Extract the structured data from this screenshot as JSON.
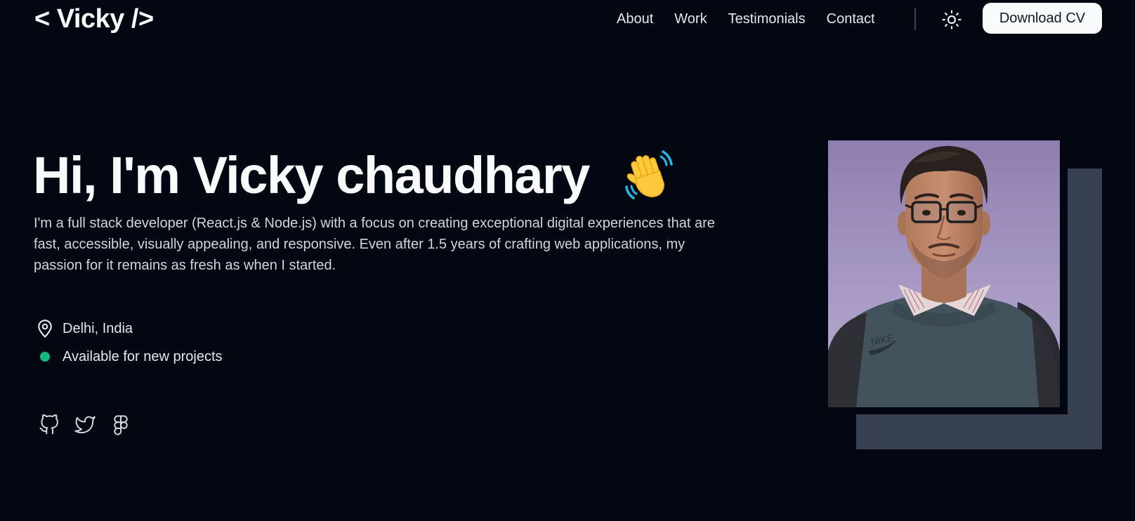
{
  "header": {
    "logo": "< Vicky />",
    "nav": [
      {
        "label": "About"
      },
      {
        "label": "Work"
      },
      {
        "label": "Testimonials"
      },
      {
        "label": "Contact"
      }
    ],
    "theme_toggle_icon": "sun-icon",
    "download_label": "Download CV"
  },
  "hero": {
    "title": "Hi, I'm Vicky chaudhary",
    "title_icon": "waving-hand-emoji",
    "description": "I'm a full stack developer (React.js & Node.js) with a focus on creating exceptional digital experiences that are fast, accessible, visually appealing, and responsive. Even after 1.5 years of crafting web applications, my passion for it remains as fresh as when I started.",
    "location": {
      "icon": "map-pin-icon",
      "text": "Delhi, India"
    },
    "availability": {
      "icon": "status-dot",
      "text": "Available for new projects"
    },
    "socials": [
      {
        "icon": "github-icon"
      },
      {
        "icon": "twitter-icon"
      },
      {
        "icon": "figma-icon"
      }
    ]
  },
  "portrait": {
    "subject": "profile-photo"
  },
  "colors": {
    "background": "#030712",
    "text": "#f9fafb",
    "muted_text": "#d1d5db",
    "accent_green": "#10b981",
    "shadow_block": "#374151",
    "button_bg": "#f9fafb",
    "button_text": "#111827"
  }
}
